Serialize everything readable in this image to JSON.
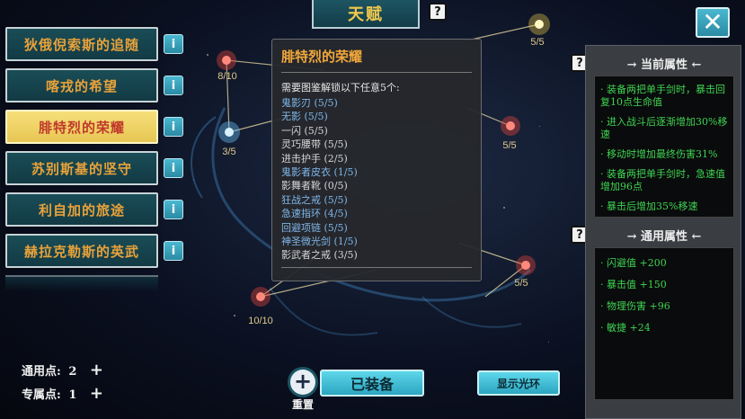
{
  "top_tab": {
    "label": "天赋"
  },
  "talents": [
    {
      "label": "狄俄倪索斯的追随",
      "active": false
    },
    {
      "label": "喀戎的希望",
      "active": false
    },
    {
      "label": "腓特烈的荣耀",
      "active": true
    },
    {
      "label": "苏别斯基的坚守",
      "active": false
    },
    {
      "label": "利自加的旅途",
      "active": false
    },
    {
      "label": "赫拉克勒斯的英武",
      "active": false
    }
  ],
  "info_icon": "i",
  "help_icon": "?",
  "close_icon": "✕",
  "constellation_nodes": [
    {
      "label": "5/5"
    },
    {
      "label": "8/10"
    },
    {
      "label": "3/5"
    },
    {
      "label": "5/5"
    },
    {
      "label": "5/5"
    },
    {
      "label": "10/10"
    }
  ],
  "tooltip": {
    "title": "腓特烈的荣耀",
    "requirement": "需要图鉴解锁以下任意5个:",
    "items": [
      {
        "text": "鬼影刃 (5/5)",
        "done": false
      },
      {
        "text": "无影 (5/5)",
        "done": false
      },
      {
        "text": "一闪 (5/5)",
        "done": true
      },
      {
        "text": "灵巧腰带 (5/5)",
        "done": true
      },
      {
        "text": "进击护手 (2/5)",
        "done": true
      },
      {
        "text": "鬼影者皮衣 (1/5)",
        "done": false
      },
      {
        "text": "影舞者靴 (0/5)",
        "done": true
      },
      {
        "text": "狂战之戒 (5/5)",
        "done": false
      },
      {
        "text": "急速指环 (4/5)",
        "done": false
      },
      {
        "text": "回避项链 (5/5)",
        "done": false
      },
      {
        "text": "神圣微光剑 (1/5)",
        "done": false
      },
      {
        "text": "影武者之戒 (3/5)",
        "done": true
      }
    ]
  },
  "current_attrs": {
    "title": "→ 当前属性 ←",
    "items": [
      "· 装备两把单手剑时，暴击回复10点生命值",
      "· 进入战斗后逐渐增加30%移速",
      "· 移动时增加最终伤害31%",
      "· 装备两把单手剑时，急速值增加96点",
      "· 暴击后增加35%移速"
    ]
  },
  "general_attrs": {
    "title": "→ 通用属性 ←",
    "items": [
      "· 闪避值 +200",
      "· 暴击值 +150",
      "· 物理伤害 +96",
      "· 敏捷 +24"
    ]
  },
  "points": {
    "general_label": "通用点:",
    "general_value": "2",
    "special_label": "专属点:",
    "special_value": "1",
    "plus": "+"
  },
  "reset": {
    "icon": "+",
    "label": "重置"
  },
  "equip_button": "已装备",
  "aura_button": "显示光环",
  "colors": {
    "accent_teal": "#2ba5c1",
    "active_gold": "#f6df7a",
    "attr_green": "#3fd452",
    "title_orange": "#f2a83b"
  }
}
